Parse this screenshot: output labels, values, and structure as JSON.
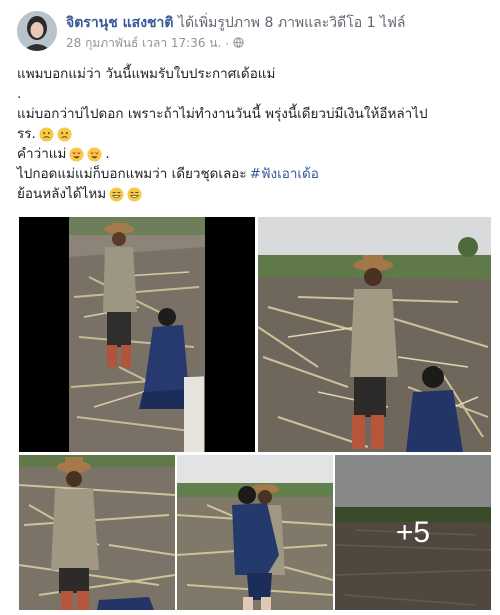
{
  "post": {
    "author": "จิตรานุช แสงชาติ",
    "action": "ได้เพิ่มรูปภาพ 8 ภาพและวิดีโอ 1 ไฟล์",
    "timestamp": "28 กุมภาพันธ์ เวลา 17:36 น.",
    "separator": "·",
    "privacy_icon": "globe-icon",
    "text_lines": [
      "แพมบอกแม่ว่า วันนี้แพมรับใบประกาศเด้อแม่",
      ".",
      "แม่บอกว่าบ่ไปดอก เพราะถ้าไม่ทำงานวันนี้ พรุ่งนี้เดียวบ่มีเงินให้อีหล่าไป",
      "รร.",
      "คำว่าแม่",
      "ไปกอดแม่แม่ก็บอกแพมว่า เดียวชุดเลอะ",
      "ย้อนหลังได้ไหม"
    ],
    "hashtag": "#ฟังเอาเด้อ",
    "more_photos_label": "+5",
    "colors": {
      "link": "#385898",
      "text": "#1d2129",
      "meta": "#90949c"
    }
  }
}
